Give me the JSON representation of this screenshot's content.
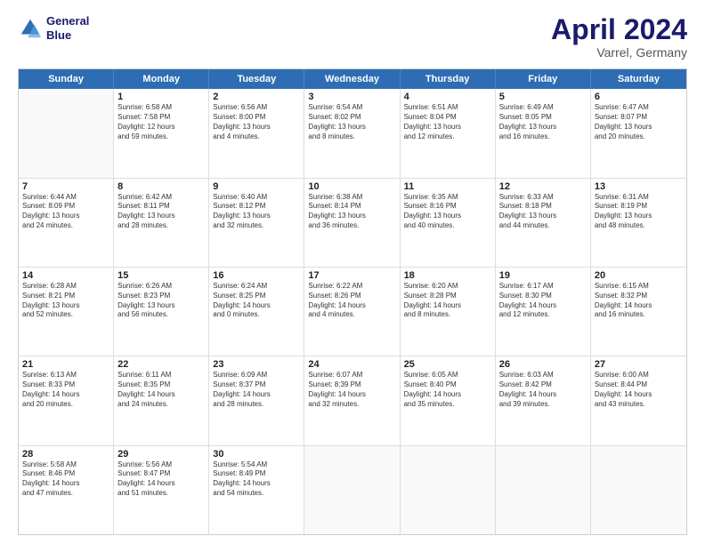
{
  "header": {
    "logo_line1": "General",
    "logo_line2": "Blue",
    "month_year": "April 2024",
    "location": "Varrel, Germany"
  },
  "days_of_week": [
    "Sunday",
    "Monday",
    "Tuesday",
    "Wednesday",
    "Thursday",
    "Friday",
    "Saturday"
  ],
  "weeks": [
    [
      {
        "day": "",
        "info": ""
      },
      {
        "day": "1",
        "info": "Sunrise: 6:58 AM\nSunset: 7:58 PM\nDaylight: 12 hours\nand 59 minutes."
      },
      {
        "day": "2",
        "info": "Sunrise: 6:56 AM\nSunset: 8:00 PM\nDaylight: 13 hours\nand 4 minutes."
      },
      {
        "day": "3",
        "info": "Sunrise: 6:54 AM\nSunset: 8:02 PM\nDaylight: 13 hours\nand 8 minutes."
      },
      {
        "day": "4",
        "info": "Sunrise: 6:51 AM\nSunset: 8:04 PM\nDaylight: 13 hours\nand 12 minutes."
      },
      {
        "day": "5",
        "info": "Sunrise: 6:49 AM\nSunset: 8:05 PM\nDaylight: 13 hours\nand 16 minutes."
      },
      {
        "day": "6",
        "info": "Sunrise: 6:47 AM\nSunset: 8:07 PM\nDaylight: 13 hours\nand 20 minutes."
      }
    ],
    [
      {
        "day": "7",
        "info": "Sunrise: 6:44 AM\nSunset: 8:09 PM\nDaylight: 13 hours\nand 24 minutes."
      },
      {
        "day": "8",
        "info": "Sunrise: 6:42 AM\nSunset: 8:11 PM\nDaylight: 13 hours\nand 28 minutes."
      },
      {
        "day": "9",
        "info": "Sunrise: 6:40 AM\nSunset: 8:12 PM\nDaylight: 13 hours\nand 32 minutes."
      },
      {
        "day": "10",
        "info": "Sunrise: 6:38 AM\nSunset: 8:14 PM\nDaylight: 13 hours\nand 36 minutes."
      },
      {
        "day": "11",
        "info": "Sunrise: 6:35 AM\nSunset: 8:16 PM\nDaylight: 13 hours\nand 40 minutes."
      },
      {
        "day": "12",
        "info": "Sunrise: 6:33 AM\nSunset: 8:18 PM\nDaylight: 13 hours\nand 44 minutes."
      },
      {
        "day": "13",
        "info": "Sunrise: 6:31 AM\nSunset: 8:19 PM\nDaylight: 13 hours\nand 48 minutes."
      }
    ],
    [
      {
        "day": "14",
        "info": "Sunrise: 6:28 AM\nSunset: 8:21 PM\nDaylight: 13 hours\nand 52 minutes."
      },
      {
        "day": "15",
        "info": "Sunrise: 6:26 AM\nSunset: 8:23 PM\nDaylight: 13 hours\nand 56 minutes."
      },
      {
        "day": "16",
        "info": "Sunrise: 6:24 AM\nSunset: 8:25 PM\nDaylight: 14 hours\nand 0 minutes."
      },
      {
        "day": "17",
        "info": "Sunrise: 6:22 AM\nSunset: 8:26 PM\nDaylight: 14 hours\nand 4 minutes."
      },
      {
        "day": "18",
        "info": "Sunrise: 6:20 AM\nSunset: 8:28 PM\nDaylight: 14 hours\nand 8 minutes."
      },
      {
        "day": "19",
        "info": "Sunrise: 6:17 AM\nSunset: 8:30 PM\nDaylight: 14 hours\nand 12 minutes."
      },
      {
        "day": "20",
        "info": "Sunrise: 6:15 AM\nSunset: 8:32 PM\nDaylight: 14 hours\nand 16 minutes."
      }
    ],
    [
      {
        "day": "21",
        "info": "Sunrise: 6:13 AM\nSunset: 8:33 PM\nDaylight: 14 hours\nand 20 minutes."
      },
      {
        "day": "22",
        "info": "Sunrise: 6:11 AM\nSunset: 8:35 PM\nDaylight: 14 hours\nand 24 minutes."
      },
      {
        "day": "23",
        "info": "Sunrise: 6:09 AM\nSunset: 8:37 PM\nDaylight: 14 hours\nand 28 minutes."
      },
      {
        "day": "24",
        "info": "Sunrise: 6:07 AM\nSunset: 8:39 PM\nDaylight: 14 hours\nand 32 minutes."
      },
      {
        "day": "25",
        "info": "Sunrise: 6:05 AM\nSunset: 8:40 PM\nDaylight: 14 hours\nand 35 minutes."
      },
      {
        "day": "26",
        "info": "Sunrise: 6:03 AM\nSunset: 8:42 PM\nDaylight: 14 hours\nand 39 minutes."
      },
      {
        "day": "27",
        "info": "Sunrise: 6:00 AM\nSunset: 8:44 PM\nDaylight: 14 hours\nand 43 minutes."
      }
    ],
    [
      {
        "day": "28",
        "info": "Sunrise: 5:58 AM\nSunset: 8:46 PM\nDaylight: 14 hours\nand 47 minutes."
      },
      {
        "day": "29",
        "info": "Sunrise: 5:56 AM\nSunset: 8:47 PM\nDaylight: 14 hours\nand 51 minutes."
      },
      {
        "day": "30",
        "info": "Sunrise: 5:54 AM\nSunset: 8:49 PM\nDaylight: 14 hours\nand 54 minutes."
      },
      {
        "day": "",
        "info": ""
      },
      {
        "day": "",
        "info": ""
      },
      {
        "day": "",
        "info": ""
      },
      {
        "day": "",
        "info": ""
      }
    ]
  ]
}
